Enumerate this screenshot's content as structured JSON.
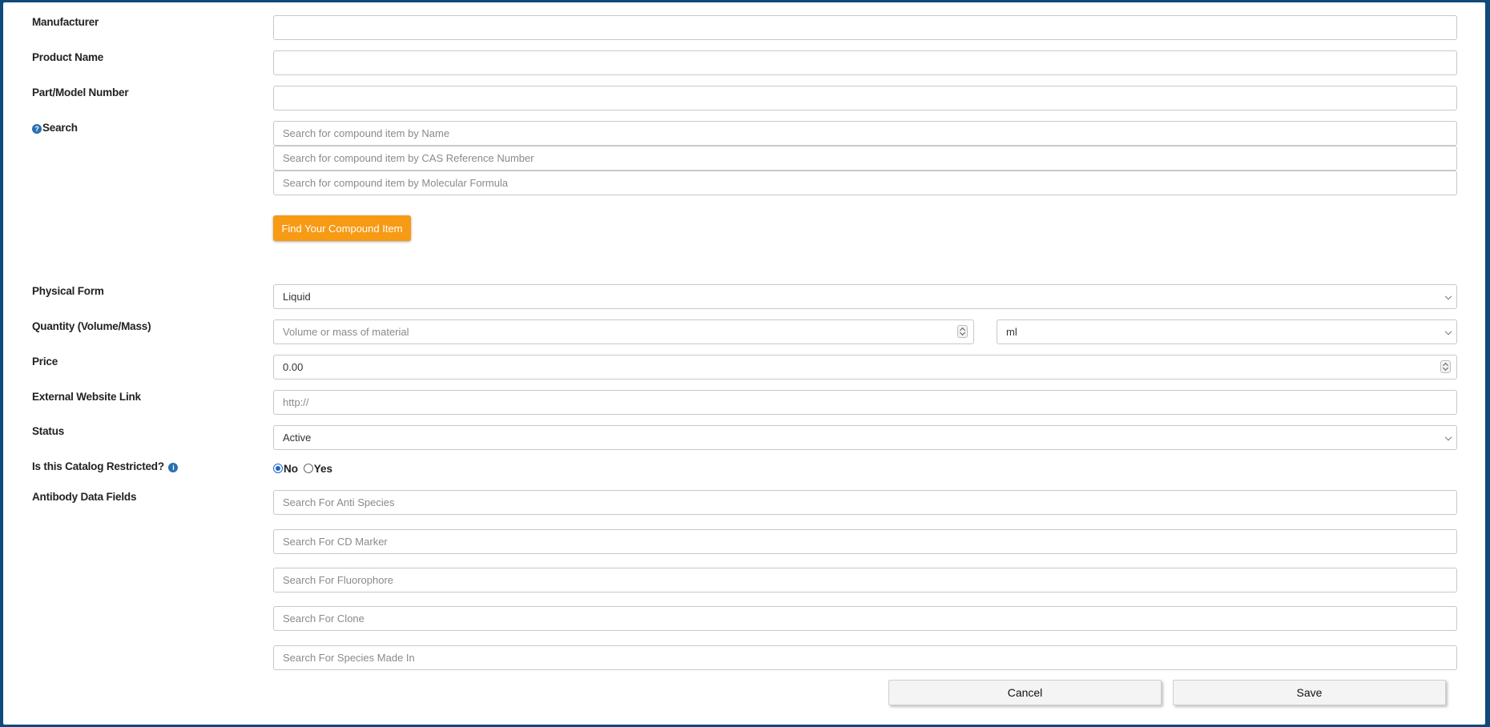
{
  "form": {
    "manufacturer": {
      "label": "Manufacturer",
      "value": ""
    },
    "product_name": {
      "label": "Product Name",
      "value": ""
    },
    "part_model_number": {
      "label": "Part/Model Number",
      "value": ""
    },
    "search": {
      "label": "Search",
      "by_name_placeholder": "Search for compound item by Name",
      "by_cas_placeholder": "Search for compound item by CAS Reference Number",
      "by_formula_placeholder": "Search for compound item by Molecular Formula",
      "find_button": "Find Your Compound Item"
    },
    "physical_form": {
      "label": "Physical Form",
      "selected": "Liquid"
    },
    "quantity": {
      "label": "Quantity (Volume/Mass)",
      "placeholder": "Volume or mass of material",
      "unit_selected": "ml"
    },
    "price": {
      "label": "Price",
      "value": "0.00"
    },
    "external_link": {
      "label": "External Website Link",
      "placeholder": "http://"
    },
    "status": {
      "label": "Status",
      "selected": "Active"
    },
    "restricted": {
      "label": "Is this Catalog Restricted?",
      "option_no": "No",
      "option_yes": "Yes",
      "selected": "No"
    },
    "antibody": {
      "label": "Antibody Data Fields",
      "anti_species_placeholder": "Search For Anti Species",
      "cd_marker_placeholder": "Search For CD Marker",
      "fluorophore_placeholder": "Search For Fluorophore",
      "clone_placeholder": "Search For Clone",
      "species_made_in_placeholder": "Search For Species Made In"
    }
  },
  "footer": {
    "cancel_label": "Cancel",
    "save_label": "Save"
  },
  "colors": {
    "accent": "#f79a14",
    "backdrop": "#0e4a7c",
    "radio": "#1a66c5"
  }
}
